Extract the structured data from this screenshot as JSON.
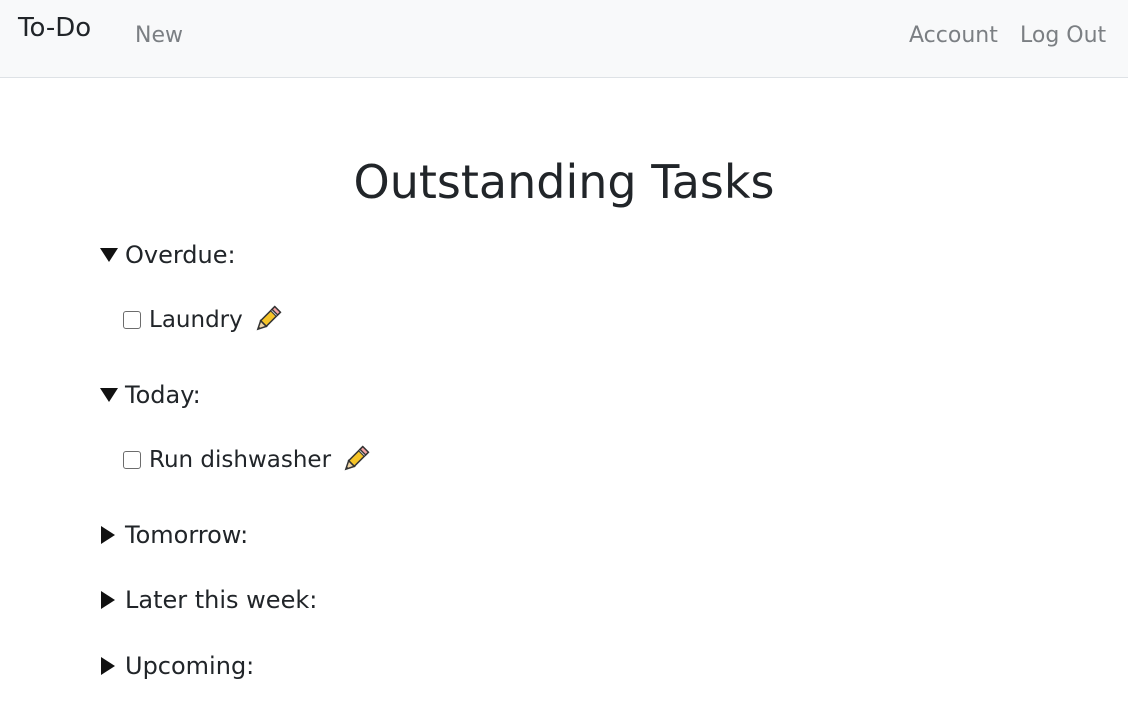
{
  "navbar": {
    "brand": "To-Do",
    "links": {
      "new": "New",
      "account": "Account",
      "logout": "Log Out"
    }
  },
  "page": {
    "title": "Outstanding Tasks"
  },
  "sections": [
    {
      "label": "Overdue:",
      "expanded": true,
      "tasks": [
        {
          "label": "Laundry",
          "checked": false,
          "edit_icon": "pencil-icon"
        }
      ]
    },
    {
      "label": "Today:",
      "expanded": true,
      "tasks": [
        {
          "label": "Run dishwasher",
          "checked": false,
          "edit_icon": "pencil-icon"
        }
      ]
    },
    {
      "label": "Tomorrow:",
      "expanded": false,
      "tasks": []
    },
    {
      "label": "Later this week:",
      "expanded": false,
      "tasks": []
    },
    {
      "label": "Upcoming:",
      "expanded": false,
      "tasks": []
    }
  ],
  "colors": {
    "navbar_bg": "#f8f9fa",
    "nav_link": "#7b7f83",
    "text": "#212529",
    "pencil_body": "#f6c427",
    "pencil_tip": "#f4a3a3"
  }
}
